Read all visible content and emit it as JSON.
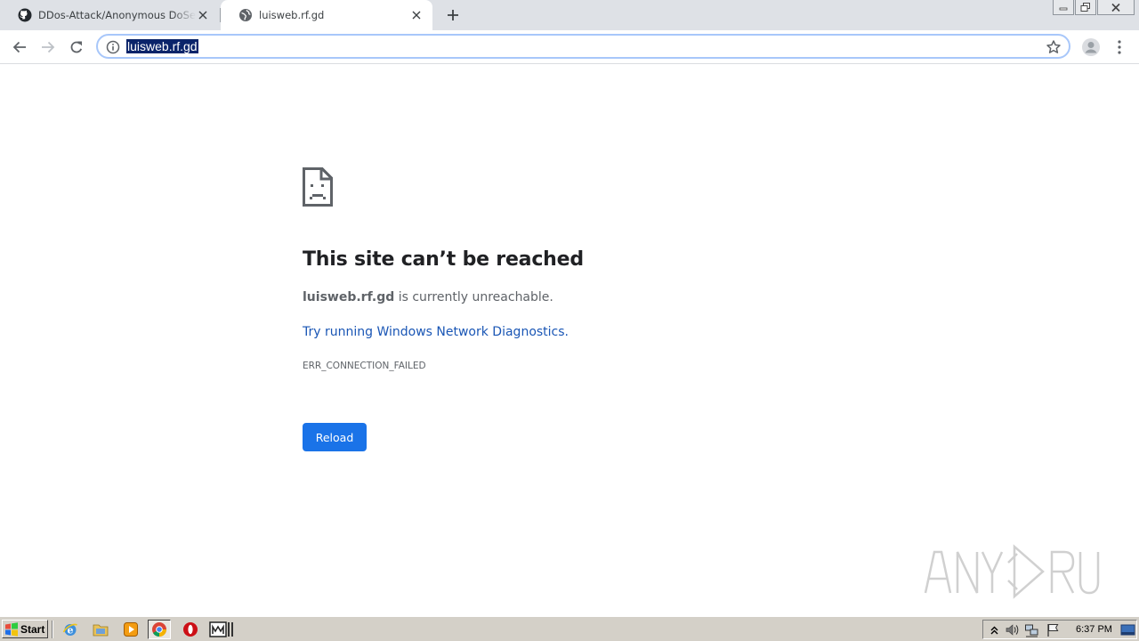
{
  "browser": {
    "tabs": [
      {
        "title": "DDos-Attack/Anonymous DoSer.exe at master · …",
        "active": false,
        "favicon": "github-icon"
      },
      {
        "title": "luisweb.rf.gd",
        "active": true,
        "favicon": "globe-icon"
      }
    ],
    "address_bar": {
      "url": "luisweb.rf.gd",
      "selected": true
    }
  },
  "error_page": {
    "title": "This site can’t be reached",
    "host": "luisweb.rf.gd",
    "message_suffix": " is currently unreachable.",
    "link": "Try running Windows Network Diagnostics.",
    "code": "ERR_CONNECTION_FAILED",
    "reload_label": "Reload"
  },
  "watermark": {
    "text": "ANY RUN"
  },
  "taskbar": {
    "start_label": "Start",
    "quick_launch": [
      "internet-explorer-icon",
      "folder-icon",
      "media-player-icon",
      "chrome-icon",
      "opera-icon",
      "app-icon"
    ],
    "clock": "6:37 PM"
  },
  "colors": {
    "accent": "#1a73e8",
    "link": "#1a56b5",
    "selection": "#0a246a"
  }
}
